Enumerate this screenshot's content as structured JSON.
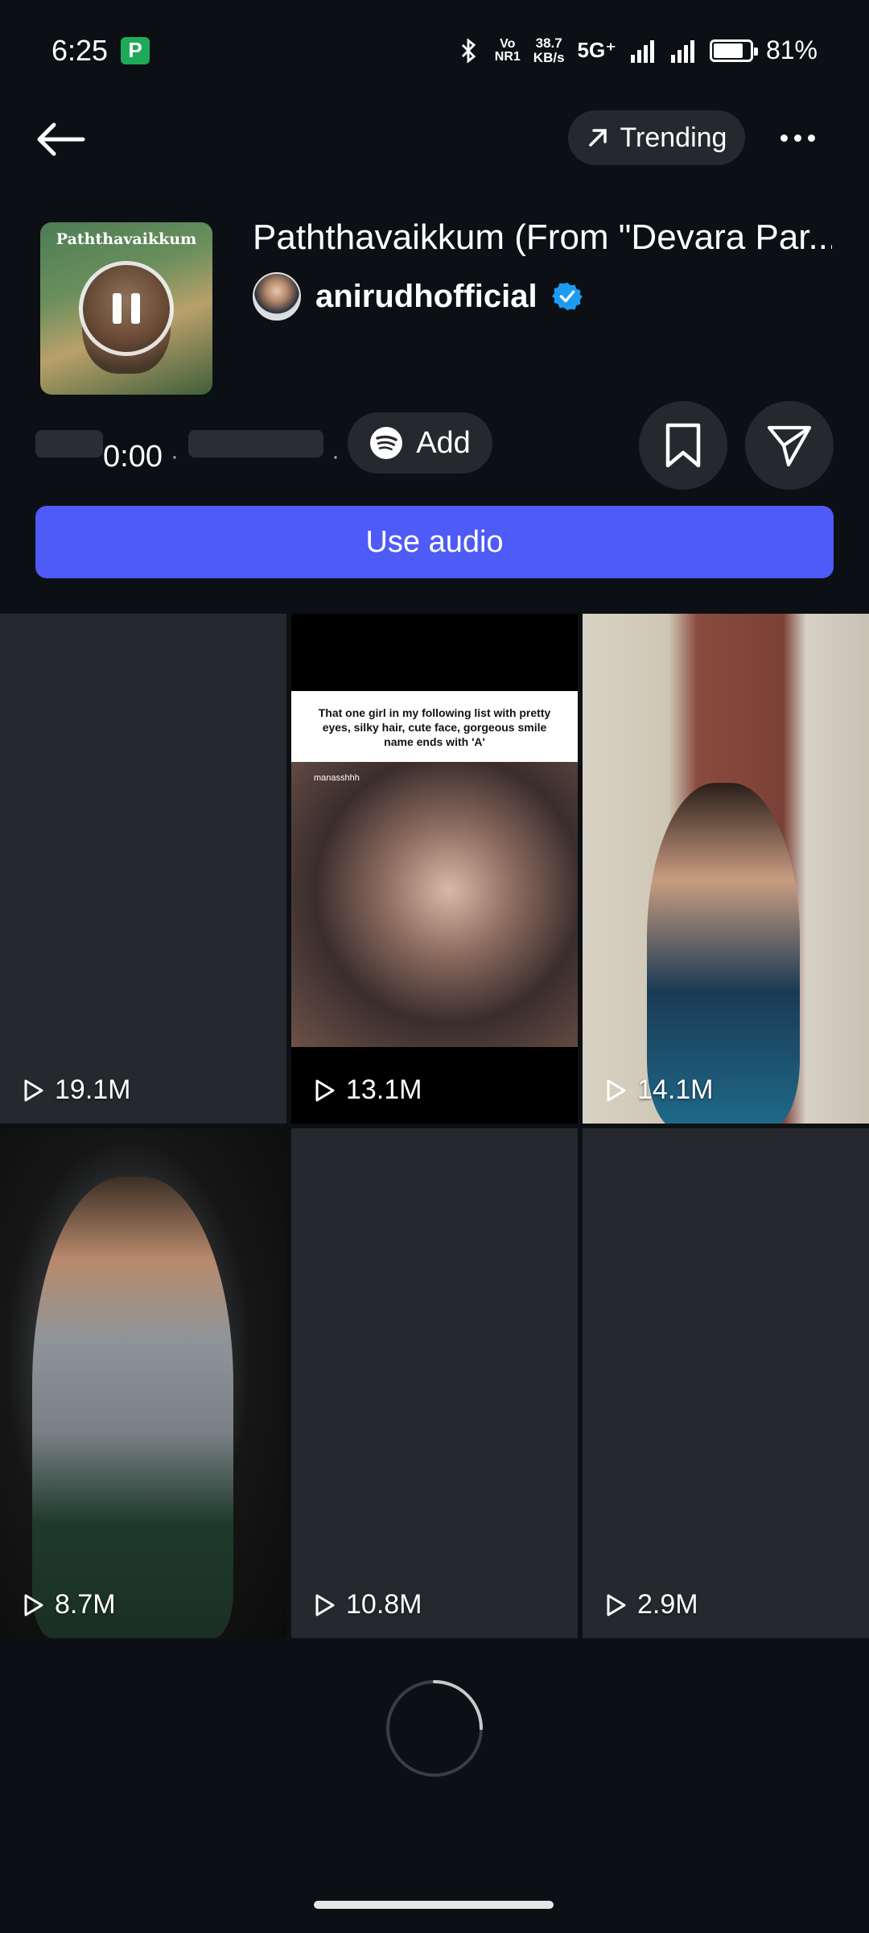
{
  "status_bar": {
    "time": "6:25",
    "app_badge": "P",
    "volte_line1": "Vo",
    "volte_line2": "NR1",
    "net_speed_value": "38.7",
    "net_speed_unit": "KB/s",
    "network": "5G⁺",
    "battery_percent": "81%",
    "battery_level": 0.81
  },
  "header": {
    "back_icon": "arrow-left-icon",
    "trending_label": "Trending",
    "trending_icon": "arrow-up-right-icon",
    "more_icon": "more-horizontal-icon"
  },
  "audio": {
    "cover_title": "Paththavaikkum",
    "title": "Paththavaikkum (From \"Devara Par...",
    "artist": "anirudhofficial",
    "verified_icon": "verified-badge-icon",
    "playback_time": "0:00",
    "separator": "·",
    "add_label": "Add",
    "add_icon": "spotify-icon",
    "save_icon": "bookmark-icon",
    "share_icon": "send-icon",
    "use_audio_label": "Use audio"
  },
  "colors": {
    "background": "#0c1014",
    "surface": "#25292e",
    "accent": "#4f5bf6",
    "verified": "#1d9bf0"
  },
  "reels": [
    {
      "views": "19.1M"
    },
    {
      "views": "13.1M",
      "caption": "That one girl in my following list with pretty eyes, silky hair, cute face, gorgeous smile name ends with 'A'",
      "tag": "manasshhh"
    },
    {
      "views": "14.1M"
    },
    {
      "views": "8.7M"
    },
    {
      "views": "10.8M"
    },
    {
      "views": "2.9M"
    }
  ],
  "loading_icon": "loading-spinner-icon"
}
